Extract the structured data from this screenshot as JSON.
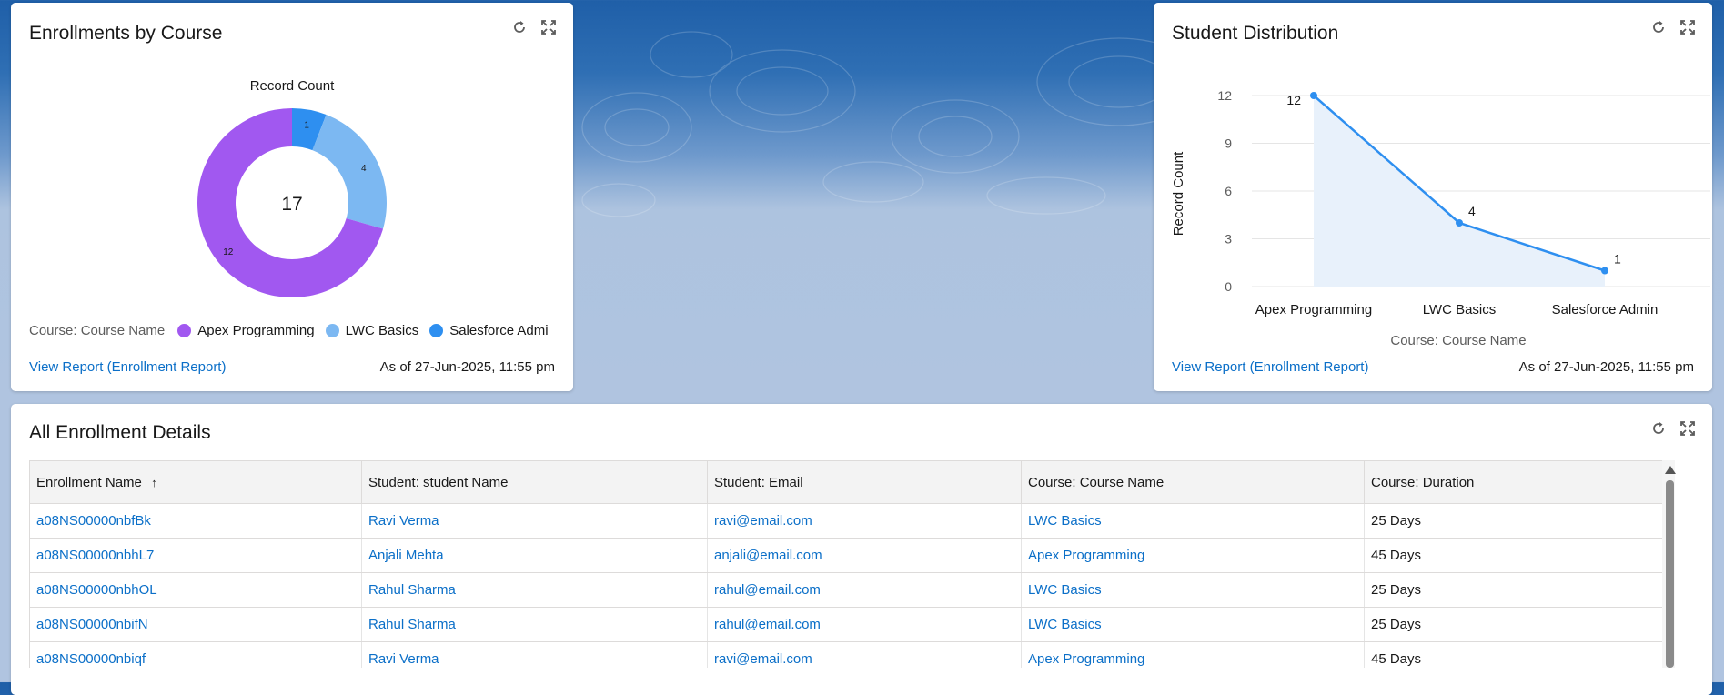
{
  "colors": {
    "apex": "#a158f0",
    "lwc": "#7cb8f2",
    "admin": "#2e8ff0",
    "line": "#2e8ff0",
    "link": "#0b6fc8"
  },
  "icons": {
    "refresh": "refresh-icon",
    "expand": "expand-icon",
    "sort": "arrow-up-icon"
  },
  "donut_card": {
    "title": "Enrollments by Course",
    "footer_link": "View Report (Enrollment Report)",
    "timestamp": "As of 27-Jun-2025, 11:55 pm",
    "legend_title": "Course: Course Name",
    "legend": [
      "Apex Programming",
      "LWC Basics",
      "Salesforce Admi"
    ]
  },
  "line_card": {
    "title": "Student Distribution",
    "footer_link": "View Report (Enrollment Report)",
    "timestamp": "As of 27-Jun-2025, 11:55 pm"
  },
  "chart_data": [
    {
      "type": "pie",
      "title": "Record Count",
      "center_label": "17",
      "categories": [
        "Apex Programming",
        "LWC Basics",
        "Salesforce Admin"
      ],
      "values": [
        12,
        4,
        1
      ],
      "hole": true
    },
    {
      "type": "line",
      "title": "",
      "xlabel": "Course: Course Name",
      "ylabel": "Record Count",
      "categories": [
        "Apex Programming",
        "LWC Basics",
        "Salesforce Admin"
      ],
      "values": [
        12,
        4,
        1
      ],
      "yticks": [
        "0",
        "3",
        "6",
        "9",
        "12"
      ],
      "ylim": [
        0,
        12
      ],
      "area_fill": true,
      "grid": true
    }
  ],
  "table_card": {
    "title": "All Enrollment Details",
    "columns": [
      "Enrollment Name",
      "Student: student Name",
      "Student: Email",
      "Course: Course Name",
      "Course: Duration"
    ],
    "rows": [
      [
        "a08NS00000nbfBk",
        "Ravi Verma",
        "ravi@email.com",
        "LWC Basics",
        "25 Days"
      ],
      [
        "a08NS00000nbhL7",
        "Anjali Mehta",
        "anjali@email.com",
        "Apex Programming",
        "45 Days"
      ],
      [
        "a08NS00000nbhOL",
        "Rahul Sharma",
        "rahul@email.com",
        "LWC Basics",
        "25 Days"
      ],
      [
        "a08NS00000nbifN",
        "Rahul Sharma",
        "rahul@email.com",
        "LWC Basics",
        "25 Days"
      ],
      [
        "a08NS00000nbiqf",
        "Ravi Verma",
        "ravi@email.com",
        "Apex Programming",
        "45 Days"
      ]
    ]
  }
}
